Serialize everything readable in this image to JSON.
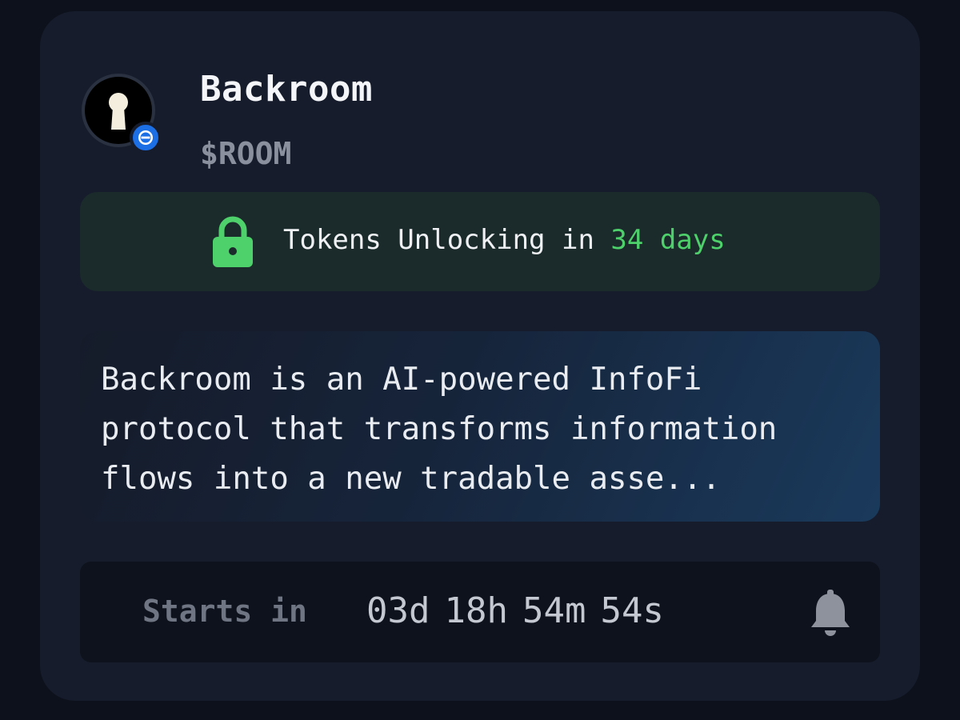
{
  "token": {
    "name": "Backroom",
    "symbol": "$ROOM",
    "avatar_icon": "keyhole-icon",
    "chain_badge_icon": "minus-circle-icon"
  },
  "unlock": {
    "icon": "lock-icon",
    "prefix": "Tokens Unlocking in ",
    "days": "34 days",
    "accent_color": "#4ed06b"
  },
  "description": {
    "text": "Backroom is an AI-powered InfoFi protocol that transforms information flows into a new tradable asse..."
  },
  "countdown": {
    "label": "Starts in",
    "days": "03d",
    "hours": "18h",
    "minutes": "54m",
    "seconds": "54s",
    "bell_icon": "bell-icon"
  }
}
